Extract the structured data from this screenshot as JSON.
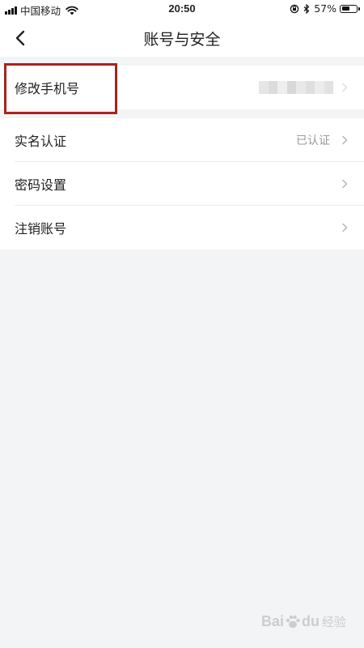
{
  "status_bar": {
    "carrier": "中国移动",
    "time": "20:50",
    "battery": "57%",
    "battery_level": 0.57
  },
  "nav": {
    "title": "账号与安全"
  },
  "sections": [
    {
      "rows": [
        {
          "label": "修改手机号",
          "value": "",
          "value_obscured": true
        }
      ]
    },
    {
      "rows": [
        {
          "label": "实名认证",
          "value": "已认证"
        },
        {
          "label": "密码设置",
          "value": ""
        },
        {
          "label": "注销账号",
          "value": ""
        }
      ]
    }
  ],
  "colors": {
    "highlight": "#a8231f",
    "background": "#f3f4f6",
    "chevron": "#b5b5b5"
  },
  "watermark": {
    "brand_left": "Bai",
    "brand_right": "du",
    "suffix": "经验"
  }
}
